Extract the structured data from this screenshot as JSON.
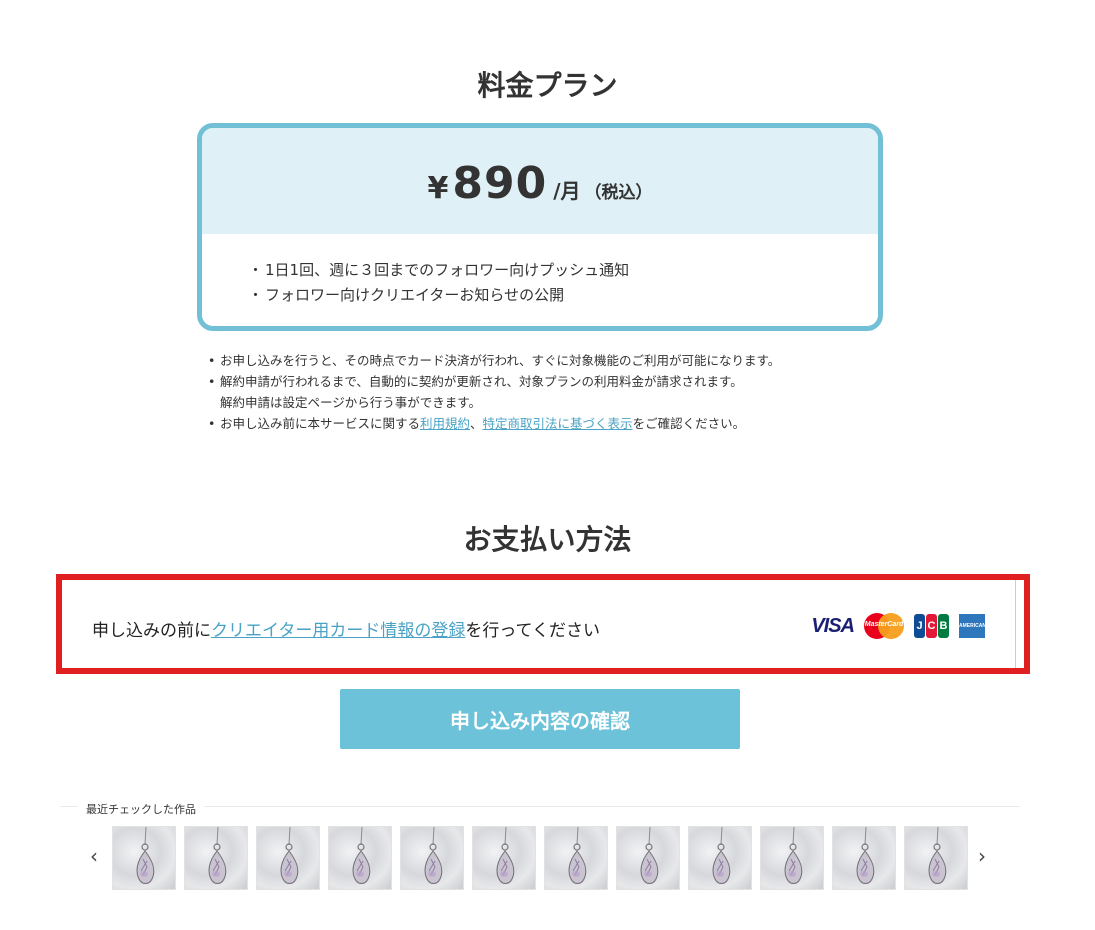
{
  "plan": {
    "title": "料金プラン",
    "currency": "¥",
    "price": "890",
    "unit": "/月",
    "tax_note": "（税込）",
    "features": [
      "1日1回、週に３回までのフォロワー向けプッシュ通知",
      "フォロワー向けクリエイターお知らせの公開"
    ]
  },
  "notes": {
    "n1": "お申し込みを行うと、その時点でカード決済が行われ、すぐに対象機能のご利用が可能になります。",
    "n2_line1": "解約申請が行われるまで、自動的に契約が更新され、対象プランの利用料金が請求されます。",
    "n2_line2": "解約申請は設定ページから行う事ができます。",
    "n3_prefix": "お申し込み前に本サービスに関する",
    "n3_link_terms": "利用規約",
    "n3_sep": "、",
    "n3_link_law": "特定商取引法に基づく表示",
    "n3_suffix": "をご確認ください。"
  },
  "payment": {
    "title": "お支払い方法",
    "text_prefix": "申し込みの前に",
    "link_text": "クリエイター用カード情報の登録",
    "text_suffix": "を行ってください",
    "cards": {
      "visa": "VISA",
      "mastercard": "MasterCard",
      "jcb": [
        "J",
        "C",
        "B"
      ],
      "amex": "AMERICAN EXPRESS"
    }
  },
  "confirm_button": "申し込み内容の確認",
  "recent": {
    "label": "最近チェックした作品",
    "prev": "‹",
    "next": "›",
    "thumb_count": 12
  }
}
